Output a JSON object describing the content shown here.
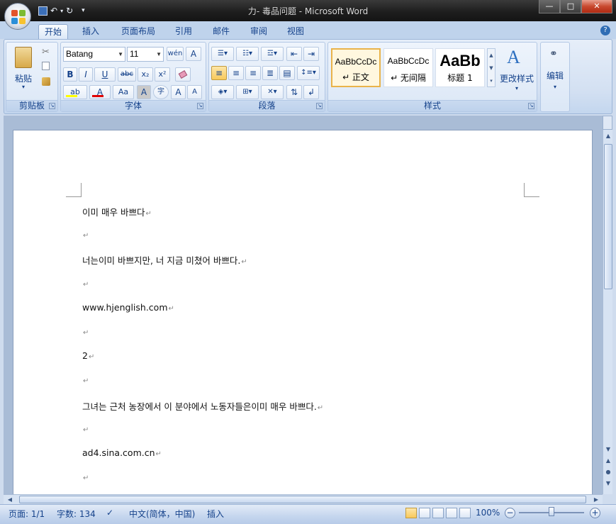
{
  "window": {
    "title": "力- 毒品问题 - Microsoft Word",
    "minimize": "—",
    "maximize": "□",
    "close": "✕"
  },
  "qat": {
    "undo": "↶",
    "redo": "↻",
    "customize": "▾"
  },
  "tabs": [
    {
      "label": "开始",
      "active": true
    },
    {
      "label": "插入"
    },
    {
      "label": "页面布局"
    },
    {
      "label": "引用"
    },
    {
      "label": "邮件"
    },
    {
      "label": "审阅"
    },
    {
      "label": "视图"
    }
  ],
  "help": "?",
  "ribbon": {
    "clipboard": {
      "label": "剪贴板",
      "paste": "粘贴",
      "paste_arrow": "▾"
    },
    "font": {
      "label": "字体",
      "font_name": "Batang",
      "font_size": "11",
      "bold": "B",
      "italic": "I",
      "underline": "U",
      "strike": "abc",
      "subscript": "x₂",
      "superscript": "x²",
      "grow": "A",
      "shrink": "A",
      "highlight": "ab",
      "font_color": "A",
      "change_case": "Aa",
      "char_shading": "A",
      "enclose": "字",
      "phonetic": "wén",
      "border_char": "A"
    },
    "paragraph": {
      "label": "段落"
    },
    "styles": {
      "label": "样式",
      "items": [
        {
          "sample": "AaBbCcDc",
          "name": "↵ 正文",
          "selected": true
        },
        {
          "sample": "AaBbCcDc",
          "name": "↵ 无间隔"
        },
        {
          "sample": "AaBb",
          "name": "标题 1"
        }
      ],
      "change_styles": "更改样式"
    },
    "editing": {
      "label": "编辑"
    }
  },
  "document": {
    "paragraphs": [
      "이미 매우 바쁘다",
      "",
      "너는이미 바쁘지만, 너 지금 미쳤어 바쁘다.",
      "",
      "www.hjenglish.com",
      "",
      "2",
      "",
      "그녀는 근처 농장에서 이 분야에서 노동자들은이미 매우 바쁘다.",
      "",
      "ad4.sina.com.cn",
      ""
    ],
    "paragraph_mark": "↵"
  },
  "statusbar": {
    "page": "页面: 1/1",
    "words": "字数: 134",
    "language": "中文(简体，中国)",
    "mode": "插入",
    "zoom": "100%",
    "zoom_minus": "−",
    "zoom_plus": "+"
  },
  "colors": {
    "font_color_bar": "#e00000",
    "highlight_bar": "#ffff00",
    "accent": "#15428b"
  }
}
